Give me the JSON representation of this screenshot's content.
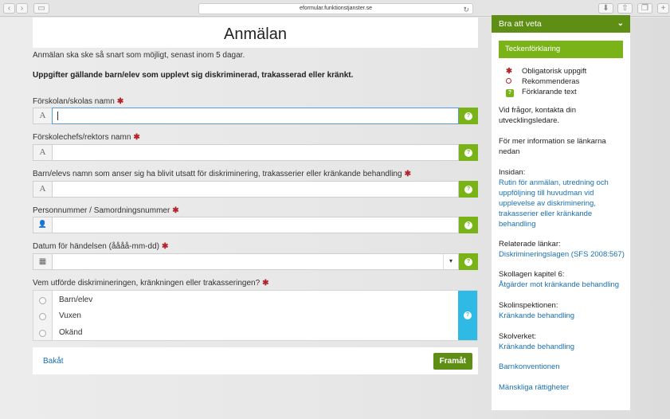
{
  "browser": {
    "url": "eformular.funktionstjanster.se",
    "back_label": "‹",
    "forward_label": "›"
  },
  "form": {
    "title": "Anmälan",
    "intro": "Anmälan ska ske så snart som möjligt, senast inom 5 dagar.",
    "subheading": "Uppgifter gällande barn/elev som upplevt sig diskriminerad, trakasserad eller kränkt.",
    "required_mark": "✱",
    "fields": [
      {
        "label": "Förskolan/skolas namn",
        "value": "",
        "icon": "text-icon",
        "icon_glyph": "A"
      },
      {
        "label": "Förskolechefs/rektors namn",
        "value": "",
        "icon": "text-icon",
        "icon_glyph": "A"
      },
      {
        "label": "Barn/elevs namn som anser sig ha blivit utsatt för diskriminering, trakasserier eller kränkande behandling",
        "value": "",
        "icon": "text-icon",
        "icon_glyph": "A"
      },
      {
        "label": "Personnummer / Samordningsnummer",
        "value": "",
        "icon": "user-icon",
        "icon_glyph": "👤"
      },
      {
        "label": "Datum för händelsen (åååå-mm-dd)",
        "value": "",
        "icon": "calendar-icon",
        "icon_glyph": "▦"
      }
    ],
    "radio_question": "Vem utförde diskrimineringen, kränkningen eller trakasseringen?",
    "radio_options": [
      "Barn/elev",
      "Vuxen",
      "Okänd"
    ],
    "help_glyph": "?",
    "dropdown_glyph": "▾",
    "back_label": "Bakåt",
    "next_label": "Framåt"
  },
  "sidebar": {
    "header": "Bra att veta",
    "chevron": "⌄",
    "legend_title": "Teckenförklaring",
    "legend": [
      {
        "symbol": "✱",
        "label": "Obligatorisk uppgift"
      },
      {
        "symbol": "",
        "label": "Rekommenderas"
      },
      {
        "symbol": "?",
        "label": "Förklarande text"
      }
    ],
    "contact_text": "Vid frågor, kontakta din utvecklingsledare.",
    "more_info_text": "För mer information se länkarna nedan",
    "sections": [
      {
        "heading": "Insidan:",
        "link": "Rutin för anmälan, utredning och uppföljning till huvudman vid upplevelse av diskriminering, trakasserier eller kränkande behandling"
      },
      {
        "heading": "Relaterade länkar:",
        "link": "Diskrimineringslagen (SFS 2008:567)"
      },
      {
        "heading": "Skollagen kapitel 6:",
        "link": "Åtgärder mot kränkande behandling"
      },
      {
        "heading": "Skolinspektionen:",
        "link": "Kränkande behandling"
      },
      {
        "heading": "Skolverket:",
        "link": "Kränkande behandling"
      }
    ],
    "links": [
      "Barnkonventionen",
      "Mänskliga rättigheter"
    ]
  },
  "colors": {
    "green_dark": "#5e8e14",
    "green": "#7ab317",
    "cyan": "#2ebae5",
    "required": "#b2242a",
    "link": "#1a6fb0"
  }
}
